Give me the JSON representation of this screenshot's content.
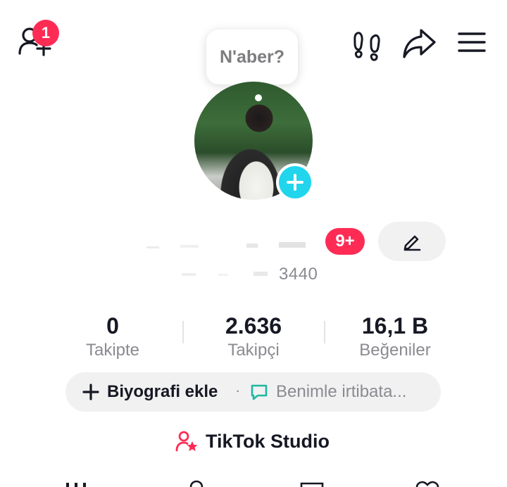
{
  "topbar": {
    "add_friend_badge": "1",
    "icons": [
      "add-friend-icon",
      "footprint-icon",
      "share-icon",
      "menu-icon"
    ]
  },
  "bubble": {
    "text": "N'aber?"
  },
  "profile": {
    "notification_pill": "9+",
    "handle_suffix": "3440"
  },
  "stats": [
    {
      "value": "0",
      "label": "Takipte"
    },
    {
      "value": "2.636",
      "label": "Takipçi"
    },
    {
      "value": "16,1 B",
      "label": "Beğeniler"
    }
  ],
  "bio": {
    "add_label": "Biyografi ekle",
    "separator": "·",
    "contact_label": "Benimle irtibata..."
  },
  "studio": {
    "label": "TikTok Studio"
  },
  "colors": {
    "accent_red": "#fe2c55",
    "accent_cyan": "#20d5ec",
    "contact_green": "#20b8a0",
    "pill_bg": "#f1f1f2",
    "text_primary": "#161823",
    "text_secondary": "#8a8b91"
  }
}
